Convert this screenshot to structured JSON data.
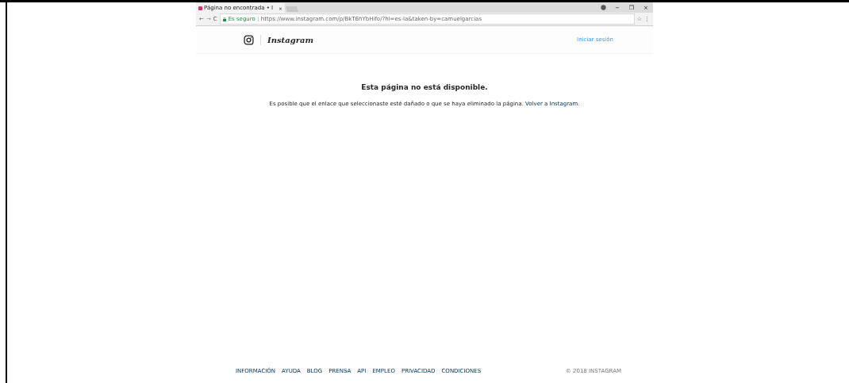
{
  "browser": {
    "tab_title": "Página no encontrada • I",
    "tab_close": "×",
    "back": "←",
    "forward": "→",
    "reload": "C",
    "secure_label": "Es seguro",
    "url": "https://www.instagram.com/p/BkT6hYbHifo/?hl=es-la&taken-by=camuelgarcias",
    "star": "☆",
    "menu": "⋮",
    "window_buttons": [
      "−",
      "❐",
      "×"
    ]
  },
  "header": {
    "logo_text": "Instagram",
    "login_link": "Iniciar sesión"
  },
  "message": {
    "title": "Esta página no está disponible.",
    "body": "Es posible que el enlace que seleccionaste esté dañado o que se haya eliminado la página.",
    "link": "Volver a Instagram."
  },
  "footer": {
    "links": [
      "INFORMACIÓN",
      "AYUDA",
      "BLOG",
      "PRENSA",
      "API",
      "EMPLEO",
      "PRIVACIDAD",
      "CONDICIONES"
    ],
    "copyright": "© 2018 INSTAGRAM"
  }
}
